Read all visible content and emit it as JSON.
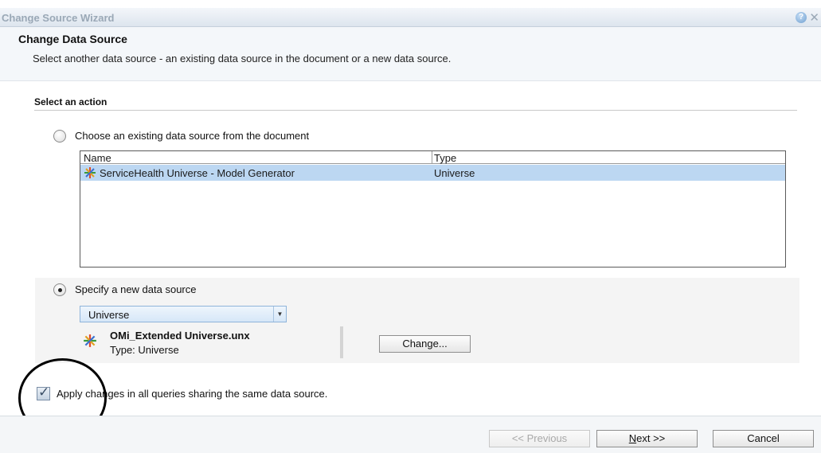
{
  "window": {
    "title": "Change Source Wizard",
    "help_glyph": "?",
    "close_glyph": "✕"
  },
  "header": {
    "title": "Change Data Source",
    "subtitle": "Select another data source - an existing data source in the document or a new data source."
  },
  "action_section": {
    "label": "Select an action"
  },
  "existing_option": {
    "label": "Choose an existing data source from the document",
    "selected": false,
    "columns": [
      "Name",
      "Type"
    ],
    "rows": [
      {
        "name": "ServiceHealth Universe - Model Generator",
        "type": "Universe",
        "selected": true,
        "icon": "universe-icon"
      }
    ]
  },
  "new_option": {
    "label": "Specify a new data source",
    "selected": true,
    "source_type": "Universe",
    "source_type_arrow": "▼",
    "universe_name": "OMi_Extended Universe.unx",
    "universe_type": "Type: Universe",
    "change_button": "Change..."
  },
  "apply_all": {
    "checked": true,
    "tick": "✓",
    "label": "Apply changes in all queries sharing the same data source."
  },
  "footer": {
    "previous_button": "<< Previous",
    "next_button_accel": "N",
    "next_button_rest": "ext >>",
    "cancel_button": "Cancel"
  },
  "colors": {
    "selection": "#bcd7f2",
    "title_text": "#9aa8b6",
    "accent": "#8fb4da"
  }
}
